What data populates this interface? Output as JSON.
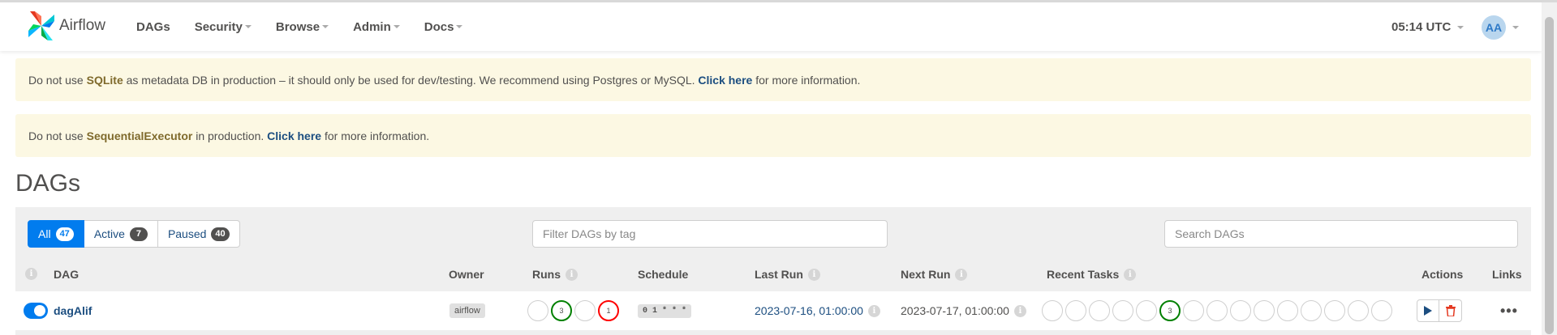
{
  "navbar": {
    "brand": "Airflow",
    "menu": [
      {
        "label": "DAGs",
        "dropdown": false
      },
      {
        "label": "Security",
        "dropdown": true
      },
      {
        "label": "Browse",
        "dropdown": true
      },
      {
        "label": "Admin",
        "dropdown": true
      },
      {
        "label": "Docs",
        "dropdown": true
      }
    ],
    "clock": "05:14 UTC",
    "user_initials": "AA"
  },
  "alerts": [
    {
      "pre": "Do not use ",
      "highlight": "SQLite",
      "mid": " as metadata DB in production – it should only be used for dev/testing. We recommend using Postgres or MySQL. ",
      "link": "Click here",
      "post": " for more information."
    },
    {
      "pre": "Do not use ",
      "highlight": "SequentialExecutor",
      "mid": " in production. ",
      "link": "Click here",
      "post": " for more information."
    }
  ],
  "page_title": "DAGs",
  "filters": {
    "all": {
      "label": "All",
      "count": "47"
    },
    "active": {
      "label": "Active",
      "count": "7"
    },
    "paused": {
      "label": "Paused",
      "count": "40"
    },
    "tag_placeholder": "Filter DAGs by tag",
    "search_placeholder": "Search DAGs"
  },
  "columns": {
    "dag": "DAG",
    "owner": "Owner",
    "runs": "Runs",
    "schedule": "Schedule",
    "last_run": "Last Run",
    "next_run": "Next Run",
    "recent_tasks": "Recent Tasks",
    "actions": "Actions",
    "links": "Links"
  },
  "rows": [
    {
      "dag_id": "dagAlif",
      "paused": false,
      "owner": "airflow",
      "runs": [
        {
          "count": "",
          "status": "none"
        },
        {
          "count": "3",
          "status": "success"
        },
        {
          "count": "",
          "status": "none"
        },
        {
          "count": "1",
          "status": "failed"
        }
      ],
      "schedule": "0 1 * * *",
      "last_run": "2023-07-16, 01:00:00",
      "next_run": "2023-07-17, 01:00:00",
      "recent_tasks": [
        "",
        "",
        "",
        "",
        "",
        "3",
        "",
        "",
        "",
        "",
        "",
        "",
        "",
        "",
        ""
      ],
      "links_label": "•••"
    }
  ],
  "colors": {
    "primary": "#017cee",
    "link": "#1c4e80",
    "success": "#008000",
    "failed": "#ff0000",
    "alert_bg": "#fcf8e3"
  }
}
